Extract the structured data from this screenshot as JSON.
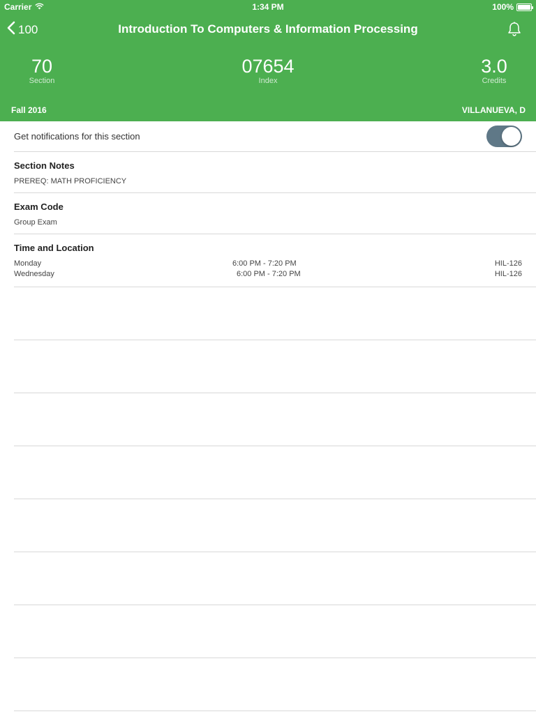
{
  "status_bar": {
    "carrier": "Carrier",
    "time": "1:34 PM",
    "battery": "100%"
  },
  "nav": {
    "back_label": "100",
    "title": "Introduction To Computers & Information Processing",
    "bell_icon": "bell-icon"
  },
  "stats": {
    "section_value": "70",
    "section_label": "Section",
    "index_value": "07654",
    "index_label": "Index",
    "credits_value": "3.0",
    "credits_label": "Credits"
  },
  "term": "Fall 2016",
  "instructor": "VILLANUEVA, D",
  "notifications": {
    "label": "Get notifications for this section",
    "enabled": true
  },
  "section_notes": {
    "title": "Section Notes",
    "value": "PREREQ: MATH PROFICIENCY"
  },
  "exam_code": {
    "title": "Exam Code",
    "value": "Group Exam"
  },
  "time_location": {
    "title": "Time and Location",
    "meetings": [
      {
        "day": "Monday",
        "time": "6:00 PM - 7:20 PM",
        "room": "HIL-126"
      },
      {
        "day": "Wednesday",
        "time": "6:00 PM - 7:20 PM",
        "room": "HIL-126"
      }
    ]
  },
  "colors": {
    "header": "#4caf50",
    "toggle_on": "#5f7887",
    "divider": "#d8d8d8"
  }
}
